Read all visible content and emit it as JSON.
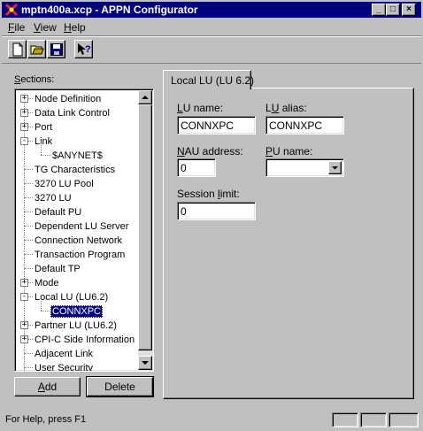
{
  "window": {
    "title": "mptn400a.xcp - APPN Configurator",
    "icon": "appn-app-icon",
    "controls": {
      "minimize": "_",
      "maximize": "□",
      "close": "×"
    }
  },
  "menu": [
    {
      "label": "File",
      "accel": "F",
      "rest": "ile"
    },
    {
      "label": "View",
      "accel": "V",
      "rest": "iew"
    },
    {
      "label": "Help",
      "accel": "H",
      "rest": "elp"
    }
  ],
  "toolbar": [
    {
      "name": "new-file-icon",
      "tip": "New"
    },
    {
      "name": "open-folder-icon",
      "tip": "Open"
    },
    {
      "name": "save-disk-icon",
      "tip": "Save"
    },
    {
      "name": "context-help-icon",
      "tip": "Help"
    }
  ],
  "sections": {
    "label_accel": "S",
    "label_rest": "ections:",
    "items": [
      {
        "label": "Node Definition",
        "expander": "+",
        "level": 0
      },
      {
        "label": "Data Link Control",
        "expander": "+",
        "level": 0
      },
      {
        "label": "Port",
        "expander": "+",
        "level": 0
      },
      {
        "label": "Link",
        "expander": "-",
        "level": 0
      },
      {
        "label": "$ANYNET$",
        "expander": "",
        "level": 1
      },
      {
        "label": "TG Characteristics",
        "expander": "",
        "level": 0
      },
      {
        "label": "3270 LU Pool",
        "expander": "",
        "level": 0
      },
      {
        "label": "3270 LU",
        "expander": "",
        "level": 0
      },
      {
        "label": "Default PU",
        "expander": "",
        "level": 0
      },
      {
        "label": "Dependent LU Server",
        "expander": "",
        "level": 0
      },
      {
        "label": "Connection Network",
        "expander": "",
        "level": 0
      },
      {
        "label": "Transaction Program",
        "expander": "",
        "level": 0
      },
      {
        "label": "Default TP",
        "expander": "",
        "level": 0
      },
      {
        "label": "Mode",
        "expander": "+",
        "level": 0
      },
      {
        "label": "Local LU (LU6.2)",
        "expander": "-",
        "level": 0
      },
      {
        "label": "CONNXPC",
        "expander": "",
        "level": 1,
        "selected": true
      },
      {
        "label": "Partner LU (LU6.2)",
        "expander": "+",
        "level": 0
      },
      {
        "label": "CPI-C Side Information",
        "expander": "+",
        "level": 0
      },
      {
        "label": "Adjacent Link",
        "expander": "",
        "level": 0
      },
      {
        "label": "User Security",
        "expander": "",
        "level": 0
      }
    ]
  },
  "buttons": {
    "add": {
      "accel": "A",
      "rest": "dd"
    },
    "delete": {
      "label": "Delete"
    }
  },
  "tab": {
    "label": "Local LU (LU 6.2)"
  },
  "form": {
    "lu_name": {
      "accel": "L",
      "rest": "U name:",
      "value": "CONNXPC"
    },
    "lu_alias": {
      "pre": "L",
      "accel": "U",
      "rest": " alias:",
      "value": "CONNXPC"
    },
    "nau_address": {
      "accel": "N",
      "rest": "AU address:",
      "value": "0"
    },
    "pu_name": {
      "accel": "P",
      "rest": "U name:",
      "value": ""
    },
    "session_limit": {
      "pre": "Session ",
      "accel": "l",
      "rest": "imit:",
      "value": "0"
    }
  },
  "status": {
    "text": "For Help, press F1"
  },
  "colors": {
    "titlebar": "#000080",
    "face": "#c0c0c0",
    "selection": "#000080"
  }
}
